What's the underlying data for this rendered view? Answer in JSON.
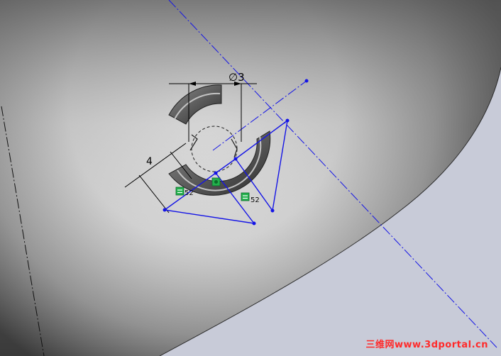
{
  "colors": {
    "background": "#c8cbd8",
    "sketch_blue": "#1414e6",
    "dimension_black": "#000000",
    "relation_green": "#22b14c",
    "watermark_red": "#ff2a2a"
  },
  "dimensions": {
    "diameter_label": "∅3",
    "length_label": "4"
  },
  "relations": {
    "equal_1_label": "52",
    "equal_2_label": "52",
    "equal_icon": "equal-relation-icon",
    "coincident_icon": "coincident-relation-icon"
  },
  "watermark": {
    "text": "三维网www.3dportal.cn"
  }
}
